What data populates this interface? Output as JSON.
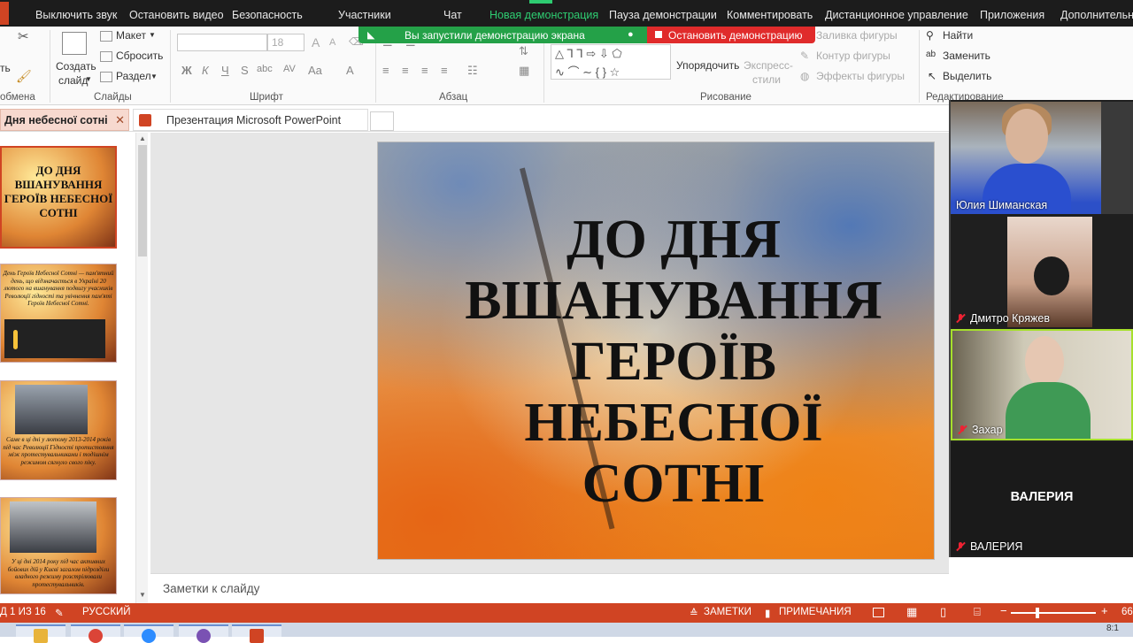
{
  "zoom_toolbar": {
    "items": [
      "Выключить звук",
      "Остановить видео",
      "Безопасность",
      "Участники",
      "Чат",
      "Новая демонстрация",
      "Пауза демонстрации",
      "Комментировать",
      "Дистанционное управление",
      "Приложения",
      "Дополнительно"
    ],
    "active_color": "#2ecc71"
  },
  "share_banner": {
    "status": "Вы запустили демонстрацию экрана",
    "stop": "Остановить демонстрацию"
  },
  "ribbon": {
    "clipboard_label": "обмена",
    "create_slide": [
      "Создать",
      "слайд"
    ],
    "layout": "Макет",
    "reset": "Сбросить",
    "section": "Раздел",
    "slides_label": "Слайды",
    "font_size": "18",
    "font_label": "Шрифт",
    "paragraph_label": "Абзац",
    "arrange": "Упорядочить",
    "quick_styles": [
      "Экспресс-",
      "стили"
    ],
    "fill": "Заливка фигуры",
    "outline": "Контур фигуры",
    "effects": "Эффекты фигуры",
    "drawing_label": "Рисование",
    "find": "Найти",
    "replace": "Заменить",
    "select": "Выделить",
    "editing_label": "Редактирование"
  },
  "tabs": [
    {
      "label": "Дня небесної сотні",
      "active": true
    },
    {
      "label": "Презентация Microsoft PowerPoint",
      "active": false
    }
  ],
  "thumbnails": [
    {
      "title": "ДО ДНЯ ВШАНУВАННЯ ГЕРОЇВ НЕБЕСНОЇ СОТНІ"
    },
    {
      "text": "День Героїв Небесної Сотні — пам'ятний день, що відзначається в Україні 20 лютого на вшанування подвигу учасників Революції гідності та увічнення пам'яті Героїв Небесної Сотні."
    },
    {
      "text": "Саме в ці дні у лютому 2013-2014 років під час Революції Гідності протистояння між протестувальниками і тодішнім режимом сягнуло свого піку."
    },
    {
      "text": "У ці дні 2014 року під час активних бойових дій у Києві загалом підрозділи владного режиму розстрілювали протестувальників."
    }
  ],
  "slide": {
    "title_lines": [
      "ДО ДНЯ",
      "ВШАНУВАННЯ",
      "ГЕРОЇВ",
      "НЕБЕСНОЇ",
      "СОТНІ"
    ]
  },
  "notes_placeholder": "Заметки к слайду",
  "status": {
    "slide_counter": "Д 1 ИЗ 16",
    "language": "РУССКИЙ",
    "notes": "ЗАМЕТКИ",
    "comments": "ПРИМЕЧАНИЯ",
    "zoom": "66"
  },
  "participants": [
    {
      "name": "Юлия Шиманская",
      "muted": false
    },
    {
      "name": "Дмитро Кряжев",
      "muted": true
    },
    {
      "name": "Захар",
      "muted": true
    },
    {
      "name": "ВАЛЕРИЯ",
      "muted": true,
      "display": "ВАЛЕРИЯ"
    }
  ],
  "clock": "8:1"
}
